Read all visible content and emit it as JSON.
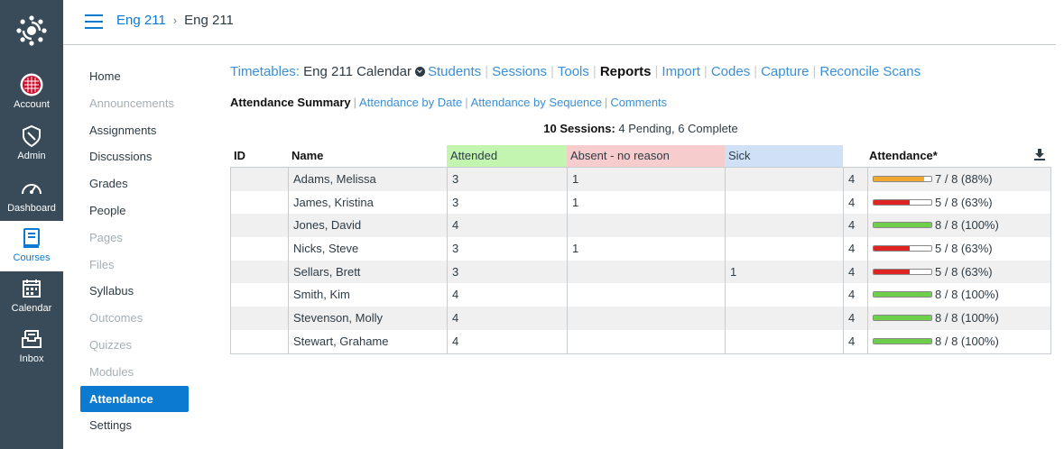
{
  "global_nav": [
    {
      "label": "Account",
      "icon": "account-icon"
    },
    {
      "label": "Admin",
      "icon": "admin-shield-icon"
    },
    {
      "label": "Dashboard",
      "icon": "dashboard-gauge-icon"
    },
    {
      "label": "Courses",
      "icon": "courses-book-icon",
      "active": true
    },
    {
      "label": "Calendar",
      "icon": "calendar-icon"
    },
    {
      "label": "Inbox",
      "icon": "inbox-icon"
    }
  ],
  "breadcrumb": {
    "course": "Eng 211",
    "current": "Eng 211"
  },
  "course_nav": [
    {
      "label": "Home",
      "state": "normal"
    },
    {
      "label": "Announcements",
      "state": "disabled"
    },
    {
      "label": "Assignments",
      "state": "normal"
    },
    {
      "label": "Discussions",
      "state": "normal"
    },
    {
      "label": "Grades",
      "state": "normal"
    },
    {
      "label": "People",
      "state": "normal"
    },
    {
      "label": "Pages",
      "state": "disabled"
    },
    {
      "label": "Files",
      "state": "disabled"
    },
    {
      "label": "Syllabus",
      "state": "normal"
    },
    {
      "label": "Outcomes",
      "state": "disabled"
    },
    {
      "label": "Quizzes",
      "state": "disabled"
    },
    {
      "label": "Modules",
      "state": "disabled"
    },
    {
      "label": "Attendance",
      "state": "active"
    },
    {
      "label": "Settings",
      "state": "normal"
    }
  ],
  "toolnav": {
    "timetables": "Timetables:",
    "calendar": "Eng 211 Calendar",
    "students": "Students",
    "sessions": "Sessions",
    "tools": "Tools",
    "reports": "Reports",
    "import": "Import",
    "codes": "Codes",
    "capture": "Capture",
    "reconcile": "Reconcile Scans"
  },
  "subnav": {
    "summary": "Attendance Summary",
    "by_date": "Attendance by Date",
    "by_sequence": "Attendance by Sequence",
    "comments": "Comments"
  },
  "sessions_summary": {
    "label": "10 Sessions:",
    "detail": "4 Pending, 6 Complete"
  },
  "table": {
    "headers": {
      "id": "ID",
      "name": "Name",
      "attended": "Attended",
      "absent": "Absent - no reason",
      "sick": "Sick",
      "attendance": "Attendance*"
    },
    "header_colors": {
      "attended": "#c3f5b0",
      "absent": "#f7cccc",
      "sick": "#cfe0f7"
    },
    "rows": [
      {
        "id": "",
        "name": "Adams, Melissa",
        "attended": "3",
        "absent": "1",
        "sick": "",
        "total": "4",
        "fraction": 0.88,
        "bar_color": "#f0a830",
        "text": "7 / 8 (88%)"
      },
      {
        "id": "",
        "name": "James, Kristina",
        "attended": "3",
        "absent": "1",
        "sick": "",
        "total": "4",
        "fraction": 0.63,
        "bar_color": "#e02424",
        "text": "5 / 8 (63%)"
      },
      {
        "id": "",
        "name": "Jones, David",
        "attended": "4",
        "absent": "",
        "sick": "",
        "total": "4",
        "fraction": 1.0,
        "bar_color": "#6ed04a",
        "text": "8 / 8 (100%)"
      },
      {
        "id": "",
        "name": "Nicks, Steve",
        "attended": "3",
        "absent": "1",
        "sick": "",
        "total": "4",
        "fraction": 0.63,
        "bar_color": "#e02424",
        "text": "5 / 8 (63%)"
      },
      {
        "id": "",
        "name": "Sellars, Brett",
        "attended": "3",
        "absent": "",
        "sick": "1",
        "total": "4",
        "fraction": 0.63,
        "bar_color": "#e02424",
        "text": "5 / 8 (63%)"
      },
      {
        "id": "",
        "name": "Smith, Kim",
        "attended": "4",
        "absent": "",
        "sick": "",
        "total": "4",
        "fraction": 1.0,
        "bar_color": "#6ed04a",
        "text": "8 / 8 (100%)"
      },
      {
        "id": "",
        "name": "Stevenson, Molly",
        "attended": "4",
        "absent": "",
        "sick": "",
        "total": "4",
        "fraction": 1.0,
        "bar_color": "#6ed04a",
        "text": "8 / 8 (100%)"
      },
      {
        "id": "",
        "name": "Stewart, Grahame",
        "attended": "4",
        "absent": "",
        "sick": "",
        "total": "4",
        "fraction": 1.0,
        "bar_color": "#6ed04a",
        "text": "8 / 8 (100%)"
      }
    ]
  },
  "colors": {
    "global_nav_bg": "#394b58",
    "link": "#3a8fd6",
    "active": "#0b7ad0"
  }
}
